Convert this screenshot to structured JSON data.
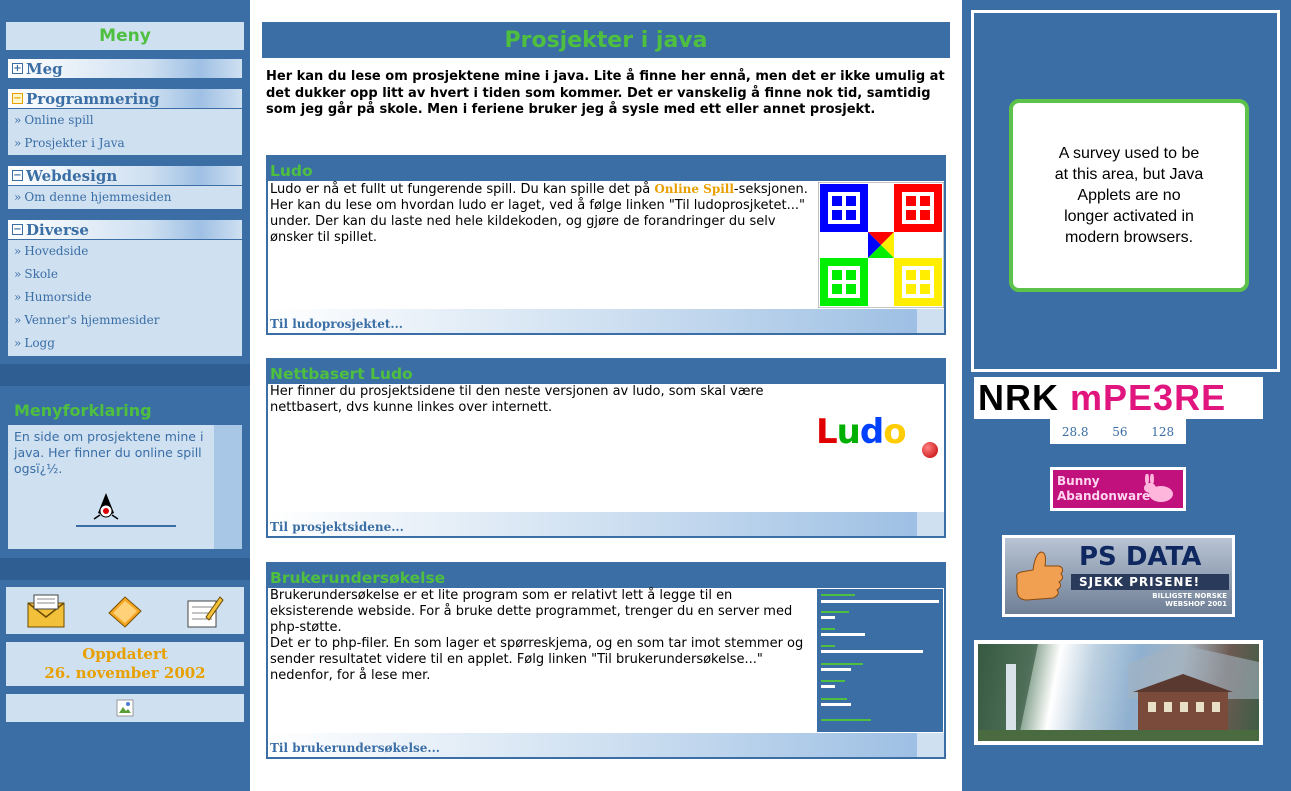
{
  "menu": {
    "title": "Meny",
    "groups": [
      {
        "label": "Meg",
        "expanded": false,
        "items": []
      },
      {
        "label": "Programmering",
        "expanded": true,
        "items": [
          "Online spill",
          "Prosjekter i Java"
        ]
      },
      {
        "label": "Webdesign",
        "expanded": true,
        "items": [
          "Om denne hjemmesiden"
        ]
      },
      {
        "label": "Diverse",
        "expanded": true,
        "items": [
          "Hovedside",
          "Skole",
          "Humorside",
          "Venner's hjemmesider",
          "Logg"
        ]
      }
    ],
    "expand_icon": "plus-box-icon",
    "collapse_icon": "minus-box-icon",
    "chevron": "»"
  },
  "menyforklaring": {
    "title": "Menyforklaring",
    "text": "En side om prosjektene mine i java. Her finner du online spill ogsï¿½."
  },
  "updated": {
    "line1": "Oppdatert",
    "line2": "26. november 2002"
  },
  "main": {
    "title": "Prosjekter i java",
    "intro": "Her kan du lese om prosjektene mine i java. Lite å finne her ennå, men det er ikke umulig at det dukker opp litt av hvert i tiden som kommer. Det er vanskelig å finne nok tid, samtidig som jeg går på skole. Men i feriene bruker jeg å sysle med ett eller annet prosjekt.",
    "cards": [
      {
        "title": "Ludo",
        "text_before_link": "Ludo er nå et fullt ut fungerende spill. Du kan spille det på ",
        "link": "Online Spill",
        "text_after_link": "-seksjonen.",
        "text2": "Her kan du lese om hvordan ludo er laget, ved å følge linken \"Til ludoprosjketet...\" under. Der kan du laste ned hele kildekoden, og gjøre de forandringer du selv ønsker til spillet.",
        "footer": "Til ludoprosjektet..."
      },
      {
        "title": "Nettbasert Ludo",
        "text": "Her finner du prosjektsidene til den neste versjonen av ludo, som skal være nettbasert, dvs kunne linkes over internett.",
        "logo_text": "Ludo",
        "footer": "Til prosjektsidene..."
      },
      {
        "title": "Brukerundersøkelse",
        "text": "Brukerundersøkelse er et lite program som er relativt lett å legge til en eksisterende webside. For å bruke dette programmet, trenger du en server med php-støtte.",
        "text2": "Det er to php-filer. En som lager et spørreskjema, og en som tar imot stemmer og sender resultatet videre til en applet. Følg linken \"Til brukerundersøkelse...\" nedenfor, for å lese mer.",
        "footer": "Til brukerundersøkelse..."
      }
    ]
  },
  "sidebar_right": {
    "survey_notice": "A survey used to be at this area, but Java Applets are no longer activated in modern browsers.",
    "nrk_logo": {
      "part1": "NRK",
      "part2": "mPE3RE"
    },
    "speeds": [
      "28.8",
      "56",
      "128"
    ],
    "bunny_logo": "Bunny Abandonware",
    "psdata_logo": {
      "brand": "PS DATA",
      "slogan": "SJEKK PRISENE!",
      "sub": "BILLIGSTE NORSKE WEBSHOP 2001"
    }
  },
  "colors": {
    "brand_blue": "#3a6ea5",
    "light_blue": "#cfe0f1",
    "green_heading": "#4fbf3f",
    "orange_accent": "#e8a000"
  }
}
